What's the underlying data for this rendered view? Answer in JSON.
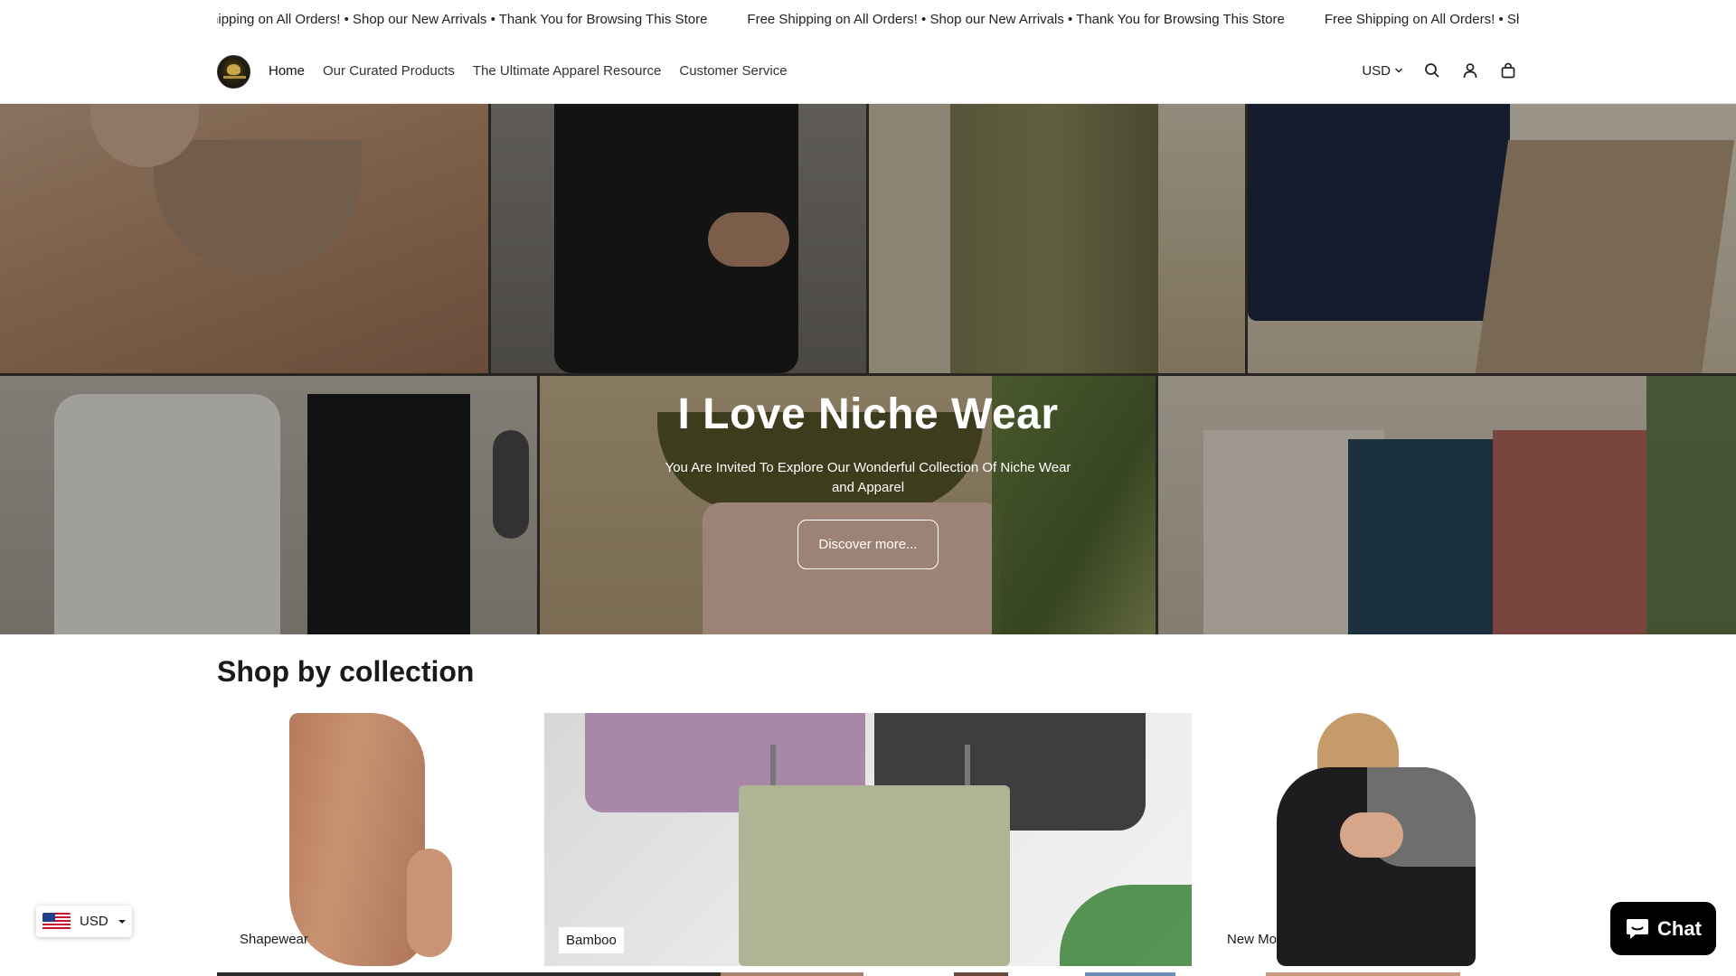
{
  "announcement": {
    "items": [
      "Free Shipping on All Orders! • Shop our New Arrivals • Thank You for Browsing This Store",
      "Free Shipping on All Orders! • Shop our New Arrivals • Thank You for Browsing This Store",
      "Free Shipping on All Orders! • Shop our New Arrivals • Thank You for Browsing This Store"
    ]
  },
  "header": {
    "nav": [
      {
        "label": "Home"
      },
      {
        "label": "Our Curated Products"
      },
      {
        "label": "The Ultimate Apparel Resource"
      },
      {
        "label": "Customer Service"
      }
    ],
    "currency": "USD",
    "icons": [
      "search-icon",
      "account-icon",
      "cart-icon"
    ]
  },
  "hero": {
    "title": "I Love Niche Wear",
    "subtitle": "You Are Invited To Explore Our Wonderful Collection Of Niche Wear and Apparel",
    "button_label": "Discover more..."
  },
  "collections": {
    "title": "Shop by collection",
    "items": [
      {
        "label": "Shapewear"
      },
      {
        "label": "Bamboo"
      },
      {
        "label": "New Moms"
      }
    ]
  },
  "currency_widget": {
    "label": "USD"
  },
  "chat": {
    "label": "Chat"
  },
  "colors": {
    "text": "#1a1a1a",
    "chat_bg": "#000000",
    "hero_overlay": "#00000052"
  }
}
